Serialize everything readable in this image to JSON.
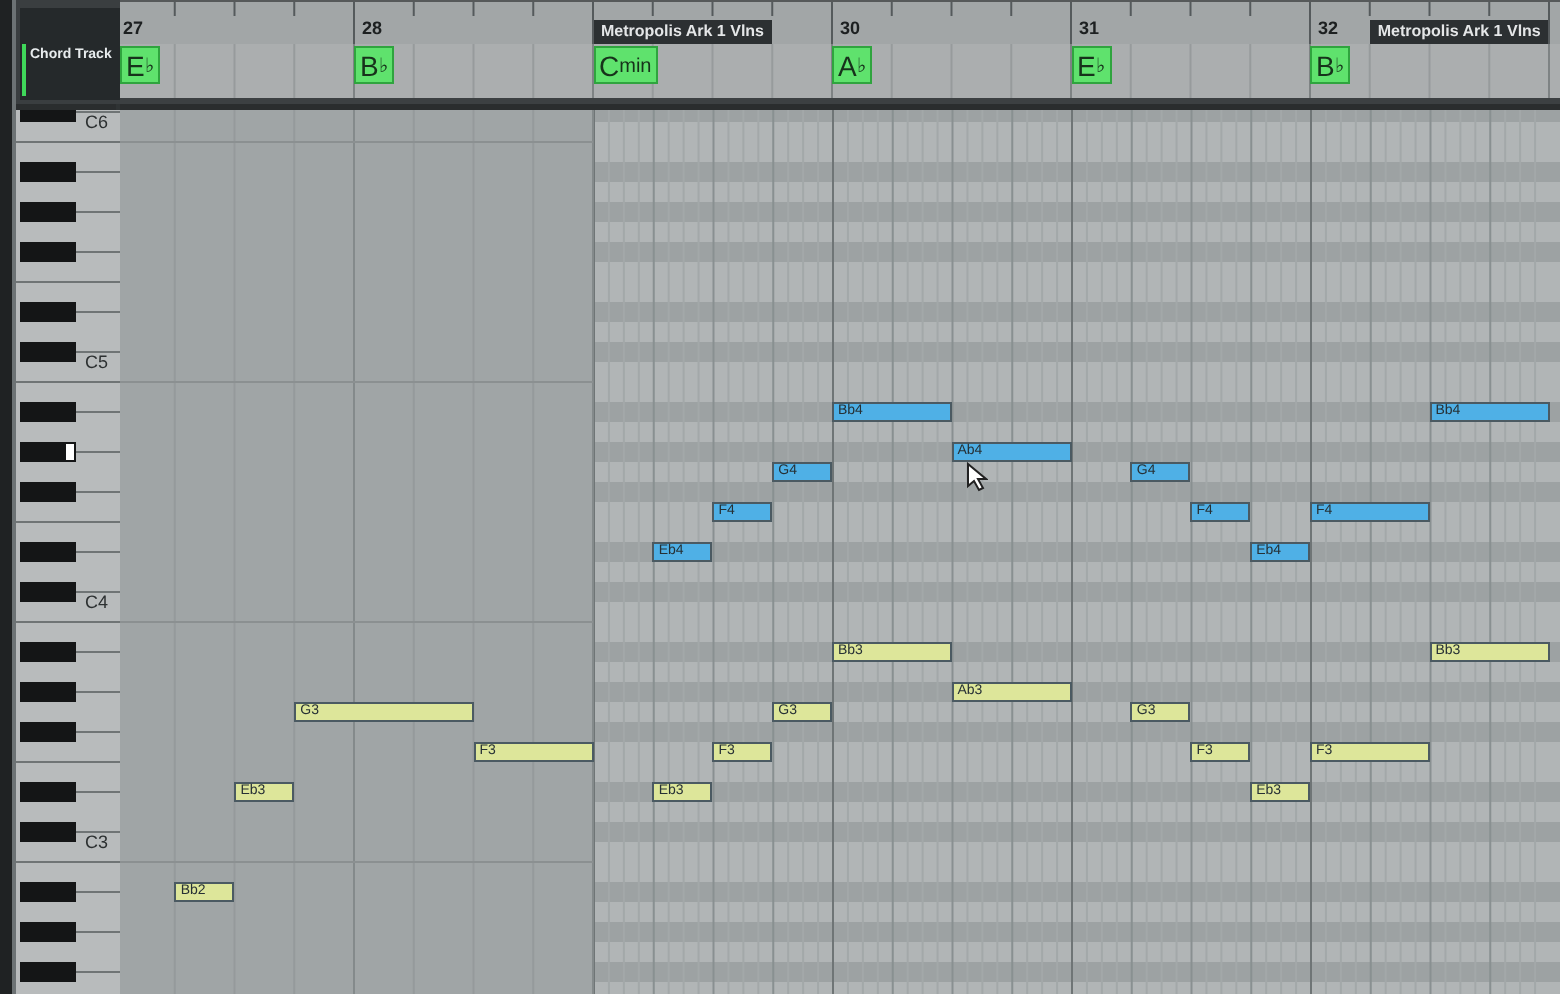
{
  "track_header": {
    "title": "Chord Track"
  },
  "ruler": {
    "bars": [
      "27",
      "28",
      "30",
      "31",
      "32"
    ]
  },
  "parts": [
    {
      "name": "Metropolis Ark 1 Vlns"
    },
    {
      "name": "Metropolis Ark 1 Vlns"
    }
  ],
  "chords": [
    {
      "root": "E",
      "suffix": "♭"
    },
    {
      "root": "B",
      "suffix": "♭"
    },
    {
      "root": "C",
      "suffix": "min"
    },
    {
      "root": "A",
      "suffix": "♭"
    },
    {
      "root": "E",
      "suffix": "♭"
    },
    {
      "root": "B",
      "suffix": "♭"
    }
  ],
  "keyboard": {
    "octave_labels": [
      "C6",
      "C5",
      "C4",
      "C3"
    ]
  },
  "notes": [
    {
      "label": "Bb2",
      "color": "#dde69a"
    },
    {
      "label": "Eb3",
      "color": "#dde69a"
    },
    {
      "label": "G3",
      "color": "#dde69a"
    },
    {
      "label": "F3",
      "color": "#dde69a"
    },
    {
      "label": "Eb4",
      "color": "#4fb0e6"
    },
    {
      "label": "Eb3",
      "color": "#dde69a"
    },
    {
      "label": "F4",
      "color": "#4fb0e6"
    },
    {
      "label": "F3",
      "color": "#dde69a"
    },
    {
      "label": "G4",
      "color": "#4fb0e6"
    },
    {
      "label": "G3",
      "color": "#dde69a"
    },
    {
      "label": "Bb4",
      "color": "#4fb0e6"
    },
    {
      "label": "Bb3",
      "color": "#dde69a"
    },
    {
      "label": "Ab4",
      "color": "#4fb0e6"
    },
    {
      "label": "Ab3",
      "color": "#dde69a"
    },
    {
      "label": "G4",
      "color": "#4fb0e6"
    },
    {
      "label": "G3",
      "color": "#dde69a"
    },
    {
      "label": "F4",
      "color": "#4fb0e6"
    },
    {
      "label": "F3",
      "color": "#dde69a"
    },
    {
      "label": "Eb4",
      "color": "#4fb0e6"
    },
    {
      "label": "Eb3",
      "color": "#dde69a"
    },
    {
      "label": "F4",
      "color": "#4fb0e6"
    },
    {
      "label": "F3",
      "color": "#dde69a"
    },
    {
      "label": "Bb4",
      "color": "#4fb0e6"
    },
    {
      "label": "Bb3",
      "color": "#dde69a"
    }
  ]
}
